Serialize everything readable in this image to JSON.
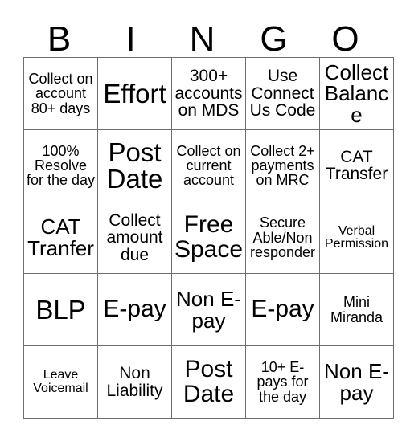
{
  "card": {
    "title": "BINGO",
    "header_letters": [
      "B",
      "I",
      "N",
      "G",
      "O"
    ],
    "border_color": "#6e6e6e",
    "background_color": "#ffffff",
    "text_color": "#000000",
    "rows": 5,
    "columns": 5,
    "cells": [
      [
        {
          "text": "Collect on account 80+ days",
          "size": "fs-s"
        },
        {
          "text": "Effort",
          "size": "fs-xxl"
        },
        {
          "text": "300+ accounts on MDS",
          "size": "fs-m"
        },
        {
          "text": "Use Connect Us Code",
          "size": "fs-m"
        },
        {
          "text": "Collect Balance",
          "size": "fs-l"
        }
      ],
      [
        {
          "text": "100% Resolve for the day",
          "size": "fs-s"
        },
        {
          "text": "Post Date",
          "size": "fs-xxl"
        },
        {
          "text": "Collect on current account",
          "size": "fs-s"
        },
        {
          "text": "Collect 2+ payments on MRC",
          "size": "fs-s"
        },
        {
          "text": "CAT Transfer",
          "size": "fs-m"
        }
      ],
      [
        {
          "text": "CAT Tranfer",
          "size": "fs-l"
        },
        {
          "text": "Collect amount due",
          "size": "fs-m"
        },
        {
          "text": "Free Space",
          "size": "fs-xl"
        },
        {
          "text": "Secure Able/Non responder",
          "size": "fs-s"
        },
        {
          "text": "Verbal Permission",
          "size": "fs-xs"
        }
      ],
      [
        {
          "text": "BLP",
          "size": "fs-xxl"
        },
        {
          "text": "E-pay",
          "size": "fs-xl"
        },
        {
          "text": "Non E-pay",
          "size": "fs-l"
        },
        {
          "text": "E-pay",
          "size": "fs-xl"
        },
        {
          "text": "Mini Miranda",
          "size": "fs-s"
        }
      ],
      [
        {
          "text": "Leave Voicemail",
          "size": "fs-xs"
        },
        {
          "text": "Non Liability",
          "size": "fs-m"
        },
        {
          "text": "Post Date",
          "size": "fs-xl"
        },
        {
          "text": "10+ E-pays for the day",
          "size": "fs-s"
        },
        {
          "text": "Non E-pay",
          "size": "fs-l"
        }
      ]
    ]
  }
}
